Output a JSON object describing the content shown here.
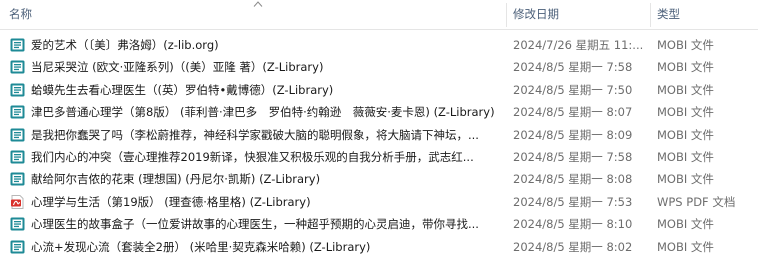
{
  "columns": {
    "name": "名称",
    "date": "修改日期",
    "type": "类型"
  },
  "rows": [
    {
      "name": "爱的艺术（〔美〕弗洛姆）(z-lib.org)",
      "date": "2024/7/26 星期五 11:...",
      "type": "MOBI 文件",
      "icon": "mobi-file-icon"
    },
    {
      "name": "当尼采哭泣 (欧文·亚隆系列)（(美）亚隆 著）(Z-Library)",
      "date": "2024/8/5 星期一 7:58",
      "type": "MOBI 文件",
      "icon": "mobi-file-icon"
    },
    {
      "name": "蛤蟆先生去看心理医生（(英）罗伯特•戴博德）(Z-Library)",
      "date": "2024/8/5 星期一 7:50",
      "type": "MOBI 文件",
      "icon": "mobi-file-icon"
    },
    {
      "name": "津巴多普通心理学（第8版） (菲利普·津巴多　罗伯特·约翰逊　薇薇安·麦卡恩) (Z-Library)",
      "date": "2024/8/5 星期一 8:07",
      "type": "MOBI 文件",
      "icon": "mobi-file-icon"
    },
    {
      "name": "是我把你蠢哭了吗（李松蔚推荐，神经科学家戳破大脑的聪明假象，将大脑请下神坛，...",
      "date": "2024/8/5 星期一 8:09",
      "type": "MOBI 文件",
      "icon": "mobi-file-icon"
    },
    {
      "name": "我们内心的冲突（壹心理推荐2019新译，快狠准又积极乐观的自我分析手册，武志红...",
      "date": "2024/8/5 星期一 7:58",
      "type": "MOBI 文件",
      "icon": "mobi-file-icon"
    },
    {
      "name": "献给阿尔吉侬的花束 (理想国) (丹尼尔·凯斯) (Z-Library)",
      "date": "2024/8/5 星期一 8:08",
      "type": "MOBI 文件",
      "icon": "mobi-file-icon"
    },
    {
      "name": "心理学与生活（第19版） (理查德·格里格) (Z-Library)",
      "date": "2024/8/5 星期一 7:53",
      "type": "WPS PDF 文档",
      "icon": "pdf-file-icon"
    },
    {
      "name": "心理医生的故事盒子（一位爱讲故事的心理医生，一种超乎预期的心灵启迪，带你寻找...",
      "date": "2024/8/5 星期一 8:10",
      "type": "MOBI 文件",
      "icon": "mobi-file-icon"
    },
    {
      "name": "心流+发现心流（套装全2册） (米哈里·契克森米哈赖) (Z-Library)",
      "date": "2024/8/5 星期一 8:02",
      "type": "MOBI 文件",
      "icon": "mobi-file-icon"
    }
  ],
  "colors": {
    "mobi_icon": "#1e8a96",
    "pdf_icon": "#d9312b",
    "header_text": "#4c607a",
    "meta_text": "#6d6d6d"
  }
}
